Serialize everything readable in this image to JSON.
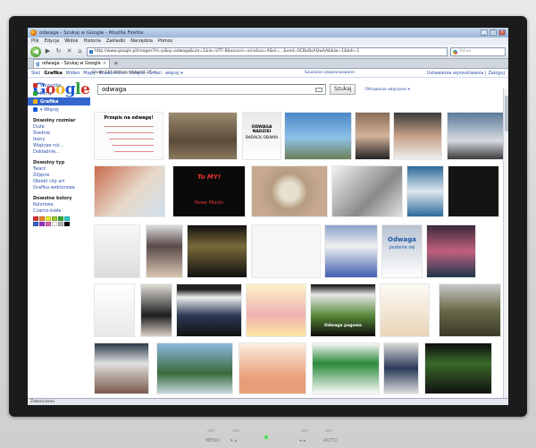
{
  "window": {
    "title": "odwaga - Szukaj w Google - Mozilla Firefox"
  },
  "menu": [
    "Plik",
    "Edycja",
    "Widok",
    "Historia",
    "Zakładki",
    "Narzędzia",
    "Pomoc"
  ],
  "nav": {
    "url": "http://www.google.pl/images?hl=pl&q=odwaga&um=1&ie=UTF-8&source=univ&sa=X&ei=...&ved=0CBoQsAQwAA&biw=1&bih=1",
    "search_placeholder": "Yahoo"
  },
  "tab": {
    "label": "odwaga - Szukaj w Google"
  },
  "gbar": {
    "links": [
      "Sieć",
      "Grafika",
      "Wideo",
      "Mapy",
      "Wiadomości",
      "Książki",
      "Gmail",
      "więcej ▾"
    ],
    "active": "Grafika",
    "right": "Ustawienia wyszukiwania | Zaloguj"
  },
  "search": {
    "query": "odwaga",
    "button": "Szukaj",
    "filter": "Filtrowanie włączone ▾",
    "stats": "Około 117 000 wyników (0,27 s)",
    "advanced": "Szukanie zaawansowane"
  },
  "sidebar": {
    "services": [
      {
        "label": "Wszystko",
        "color": "#d22f27"
      },
      {
        "label": "Filmy",
        "color": "#2a9d3a"
      },
      {
        "label": "Grafika",
        "color": "#f0b21c",
        "active": true
      },
      {
        "label": "▾ Więcej",
        "color": "#1a55d6"
      }
    ],
    "sections": [
      {
        "title": "Dowolny rozmiar",
        "links": [
          "Duże",
          "Średnie",
          "Ikony",
          "Większe niż...",
          "Dokładnie..."
        ]
      },
      {
        "title": "Dowolny typ",
        "links": [
          "Twarz",
          "Zdjęcie",
          "Obiekt clip art",
          "Grafika wektorowa"
        ]
      },
      {
        "title": "Dowolne kolory",
        "links": [
          "Kolorowe",
          "Czarno-białe"
        ]
      }
    ],
    "swatches": [
      "#d33",
      "#e83",
      "#ee3",
      "#9c3",
      "#3a3",
      "#3cc",
      "#36c",
      "#93c",
      "#d6a",
      "#fff",
      "#bbb",
      "#000"
    ]
  },
  "thumb_text": {
    "t1": "Przepis na odwagę!",
    "t3": "ODWAGA NADZIEI",
    "t3b": "BARACK OBAMA",
    "t10": "To MY!",
    "t10b": "Nowe Miasto",
    "t19": "Odwaga",
    "t19b": "podania się",
    "t26": "Odwaga pogowa"
  },
  "status": {
    "text": "Zakończono"
  },
  "monitor": {
    "menu": "MENU",
    "auto": "AUTO"
  }
}
